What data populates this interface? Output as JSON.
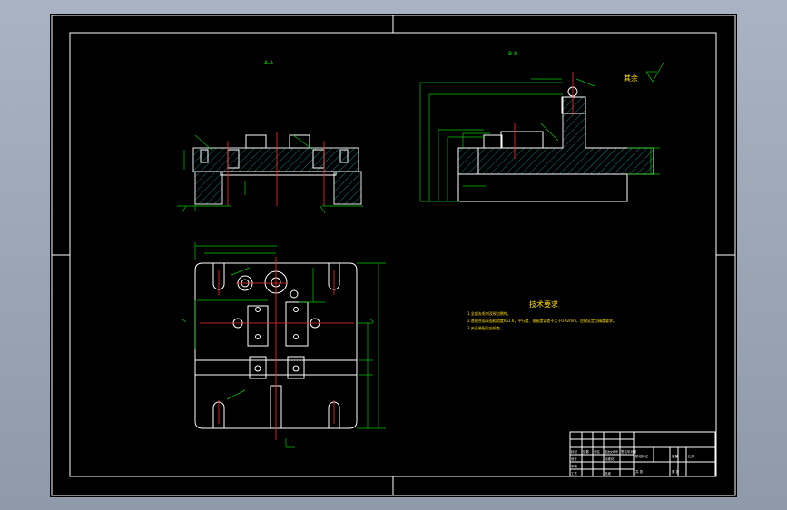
{
  "drawing": {
    "view_labels": {
      "section_a": "A-A",
      "section_b": "B-B"
    },
    "roughness_note": "其余",
    "tech_title": "技术要求",
    "tech_notes": [
      "1.全部去毛刺及锐边倒钝。",
      "2.各配合面表面粗糙度Ra1.6，平行度、垂直度误差不大于0.02mm，应保证定位精度要求。",
      "3.夹具装配后应检查。"
    ],
    "colors": {
      "sheet": "#000000",
      "geometry": "#ffffff",
      "dimension": "#00c800",
      "centerline": "#ff2a2a",
      "note": "#00e000",
      "tech": "#ffe000"
    },
    "title_block": {
      "row1": [
        "标记",
        "处数",
        "分区",
        "更改文件号",
        "签名",
        "年月日"
      ],
      "row2": [
        "设计",
        "",
        "标准化",
        ""
      ],
      "row3": [
        "审核",
        ""
      ],
      "row4": [
        "工艺",
        "",
        "批准",
        ""
      ],
      "stage_headers": [
        "阶段标记",
        "重量",
        "比例"
      ],
      "sheet_info": [
        "共 张",
        "第 张"
      ]
    }
  }
}
